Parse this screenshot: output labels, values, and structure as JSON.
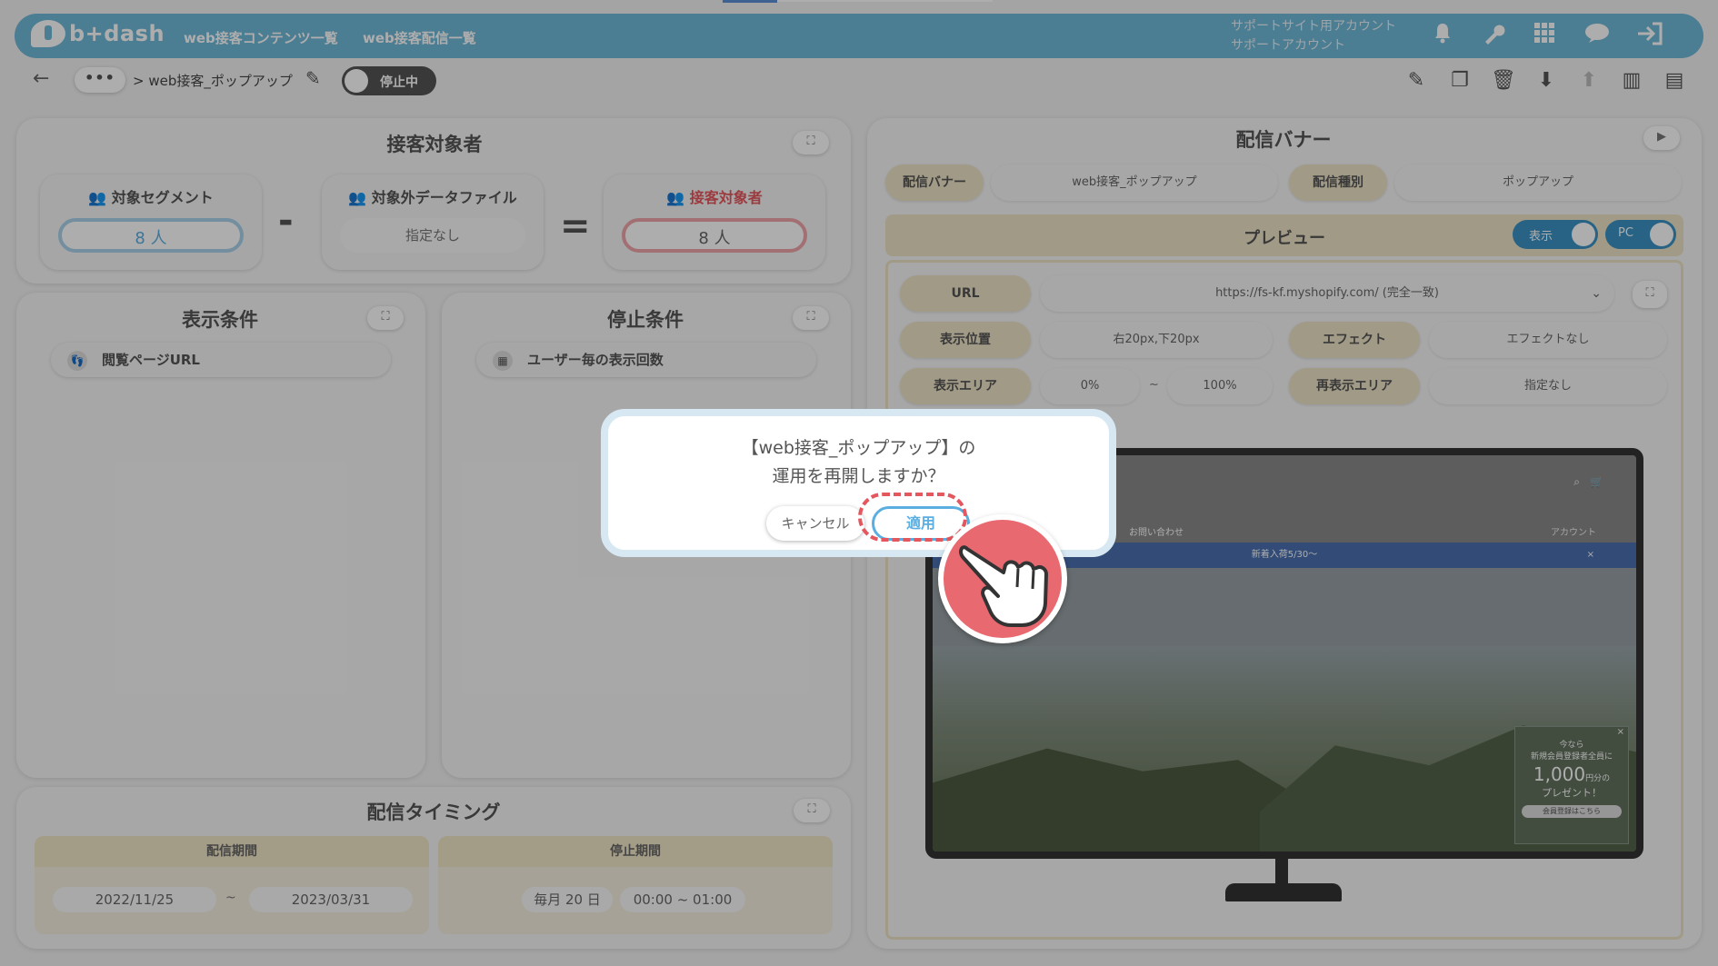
{
  "header": {
    "logo_text": "b+dash",
    "nav": [
      "web接客コンテンツ一覧",
      "web接客配信一覧"
    ],
    "account_line1": "サポートサイト用アカウント",
    "account_line2": "サポートアカウント",
    "icons": [
      "bell-icon",
      "wrench-icon",
      "grid-icon",
      "chat-icon",
      "logout-icon"
    ]
  },
  "toolbar": {
    "back_glyph": "←",
    "more_glyph": "•••",
    "breadcrumb": "> web接客_ポップアップ",
    "status_toggle_label": "停止中",
    "icons": [
      "edit-icon",
      "copy-icon",
      "trash-icon",
      "download-icon",
      "upload-icon",
      "chart-icon",
      "document-icon"
    ]
  },
  "target_panel": {
    "title": "接客対象者",
    "segment_label": "対象セグメント",
    "segment_value": "8 人",
    "exclude_label": "対象外データファイル",
    "exclude_value": "指定なし",
    "minus": "-",
    "equals": "=",
    "result_label": "接客対象者",
    "result_value": "8 人"
  },
  "display_conditions": {
    "title": "表示条件",
    "items": [
      "閲覧ページURL"
    ]
  },
  "stop_conditions": {
    "title": "停止条件",
    "items": [
      "ユーザー毎の表示回数"
    ]
  },
  "timing": {
    "title": "配信タイミング",
    "period_header": "配信期間",
    "period_start": "2022/11/25",
    "period_sep": "~",
    "period_end": "2023/03/31",
    "stop_header": "停止期間",
    "stop_day": "毎月 20 日",
    "stop_time": "00:00 ~ 01:00"
  },
  "banner_panel": {
    "title": "配信バナー",
    "banner_label": "配信バナー",
    "banner_value": "web接客_ポップアップ",
    "type_label": "配信種別",
    "type_value": "ポップアップ",
    "preview_title": "プレビュー",
    "show_switch": "表示",
    "device_switch": "PC",
    "url_label": "URL",
    "url_value": "https://fs-kf.myshopify.com/ (完全一致)",
    "position_label": "表示位置",
    "position_value": "右20px,下20px",
    "effect_label": "エフェクト",
    "effect_value": "エフェクトなし",
    "area_label": "表示エリア",
    "area_from": "0%",
    "area_sep": "~",
    "area_to": "100%",
    "reshow_label": "再表示エリア",
    "reshow_value": "指定なし"
  },
  "preview_site": {
    "nav_text": "お問い合わせ",
    "account_text": "アカウント",
    "announcement": "新着入荷5/30〜",
    "popup_line1": "今なら",
    "popup_line2": "新規会員登録者全員に",
    "popup_amount": "1,000",
    "popup_unit": "円分の",
    "popup_line3": "プレゼント！",
    "popup_button": "会員登録はこちら"
  },
  "dialog": {
    "message_line1": "【web接客_ポップアップ】の",
    "message_line2": "運用を再開しますか？",
    "cancel_label": "キャンセル",
    "apply_label": "適用"
  },
  "colors": {
    "header": "#6fb8d9",
    "accent_blue": "#5aaee0",
    "accent_red": "#e5575e",
    "label_beige": "#ede4c6"
  }
}
